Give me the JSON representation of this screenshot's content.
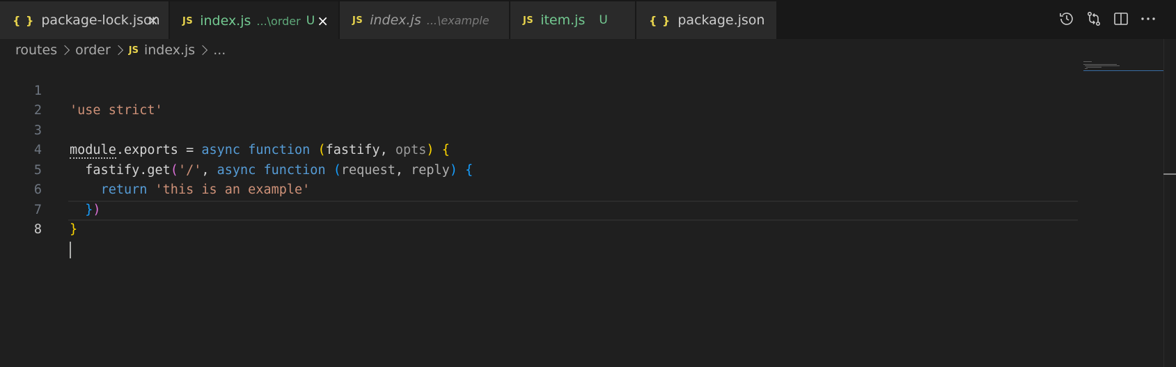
{
  "tabs": [
    {
      "icon": "{ }",
      "icon_type": "json",
      "label": "package-lock.json",
      "description": "",
      "status": "",
      "close": "×"
    },
    {
      "icon": "JS",
      "icon_type": "js",
      "label": "index.js",
      "description": "...\\order",
      "status": "U",
      "close": "×"
    },
    {
      "icon": "JS",
      "icon_type": "js",
      "label": "index.js",
      "description": "...\\example",
      "status": "",
      "close": ""
    },
    {
      "icon": "JS",
      "icon_type": "js",
      "label": "item.js",
      "description": "",
      "status": "U",
      "close": ""
    },
    {
      "icon": "{ }",
      "icon_type": "json",
      "label": "package.json",
      "description": "",
      "status": "",
      "close": ""
    }
  ],
  "toolbar": {
    "icons": [
      "history-icon",
      "compare-changes-icon",
      "split-editor-icon",
      "more-actions-icon"
    ]
  },
  "breadcrumb": {
    "items": [
      "routes",
      "order",
      "index.js",
      "..."
    ],
    "file_icon": "JS"
  },
  "code": {
    "line_numbers": [
      "1",
      "2",
      "3",
      "4",
      "5",
      "6",
      "7",
      "8"
    ],
    "l1": {
      "s1": "'use strict'"
    },
    "l3": {
      "a": "module",
      "b": ".exports = ",
      "c": "async",
      "d": " ",
      "e": "function",
      "f": " ",
      "g": "(",
      "h": "fastify",
      "i": ", ",
      "j": "opts",
      "k": ")",
      "l": " ",
      "m": "{"
    },
    "l4": {
      "a": "  fastify.get",
      "b": "(",
      "c": "'/'",
      "d": ", ",
      "e": "async",
      "f": " ",
      "g": "function",
      "h": " ",
      "i": "(",
      "j": "request",
      "k": ", ",
      "l": "reply",
      "m": ")",
      "n": " ",
      "o": "{"
    },
    "l5": {
      "a": "    ",
      "b": "return",
      "c": " ",
      "d": "'this is an example'"
    },
    "l6": {
      "a": "  ",
      "b": "}",
      "c": ")"
    },
    "l7": {
      "a": "}"
    }
  },
  "colors": {
    "background": "#1f1f1f",
    "tab_bar": "#181818",
    "untracked": "#73c991",
    "js_icon": "#e8d44d",
    "keyword": "#569cd6",
    "string": "#ce9178"
  }
}
